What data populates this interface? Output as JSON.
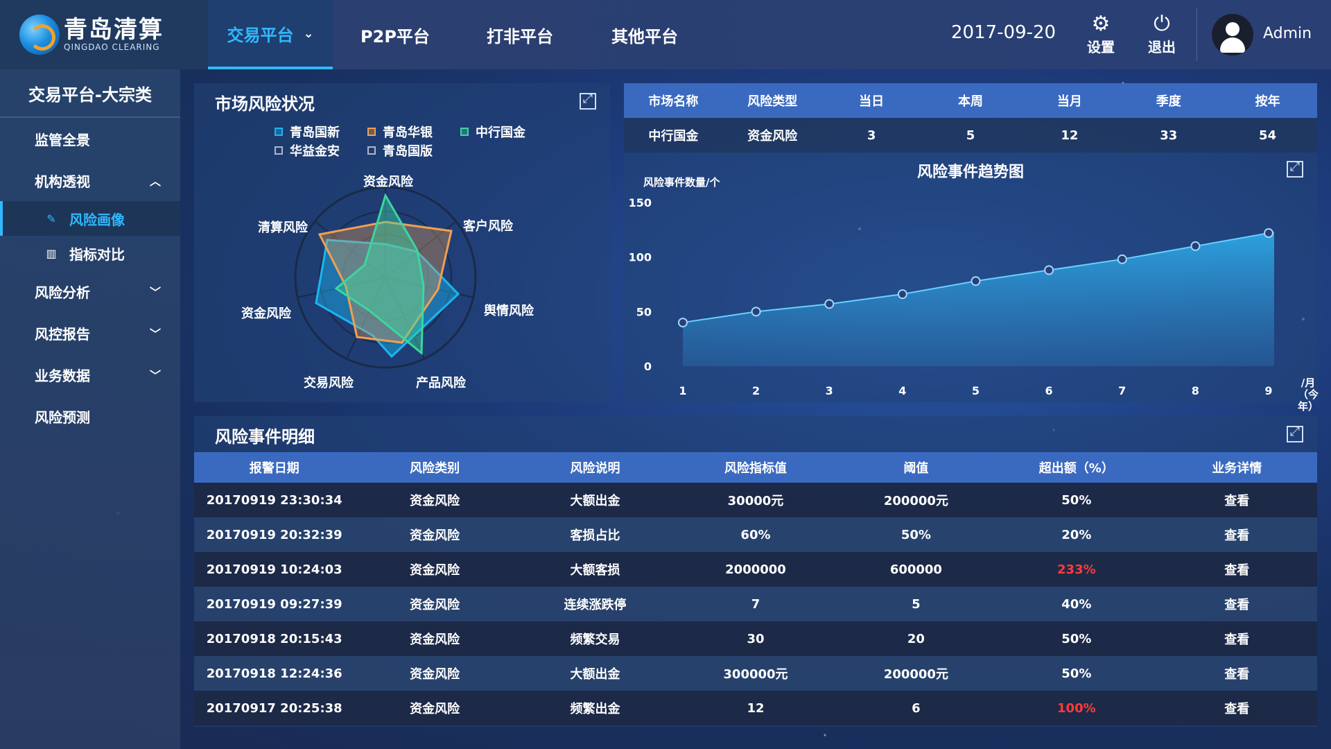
{
  "logo": {
    "cn": "青岛清算",
    "en": "QINGDAO CLEARING"
  },
  "nav": {
    "items": [
      {
        "label": "交易平台",
        "active": true
      },
      {
        "label": "P2P平台"
      },
      {
        "label": "打非平台"
      },
      {
        "label": "其他平台"
      }
    ]
  },
  "header": {
    "date": "2017-09-20",
    "settings": "设置",
    "logout": "退出",
    "user": "Admin"
  },
  "sidebar": {
    "title": "交易平台-大宗类",
    "items": [
      "监管全景",
      "机构透视",
      "风险画像",
      "指标对比",
      "风险分析",
      "风控报告",
      "业务数据",
      "风险预测"
    ]
  },
  "risk_panel": {
    "title": "市场风险状况",
    "legend": [
      {
        "name": "青岛国新",
        "color": "#1ab6f0"
      },
      {
        "name": "青岛华银",
        "color": "#f0a050"
      },
      {
        "name": "中行国金",
        "color": "#3cd6a0"
      },
      {
        "name": "华益金安",
        "color": "#b0b8c8"
      },
      {
        "name": "青岛国版",
        "color": "#b0b8c8"
      }
    ],
    "axes": [
      "资金风险",
      "客户风险",
      "舆情风险",
      "产品风险",
      "交易风险",
      "资金风险",
      "清算风险"
    ]
  },
  "market_table": {
    "headers": [
      "市场名称",
      "风险类型",
      "当日",
      "本周",
      "当月",
      "季度",
      "按年"
    ],
    "row": [
      "中行国金",
      "资金风险",
      "3",
      "5",
      "12",
      "33",
      "54"
    ]
  },
  "chart_data": {
    "type": "area",
    "title": "风险事件趋势图",
    "ylabel": "风险事件数量/个",
    "xlabel": "/月（今年）",
    "x": [
      1,
      2,
      3,
      4,
      5,
      6,
      7,
      8,
      9
    ],
    "values": [
      40,
      50,
      57,
      66,
      78,
      88,
      98,
      110,
      122
    ],
    "ylim": [
      0,
      150
    ],
    "yticks": [
      0,
      50,
      100,
      150
    ],
    "color": "#2eb3f0"
  },
  "detail": {
    "title": "风险事件明细",
    "headers": [
      "报警日期",
      "风险类别",
      "风险说明",
      "风险指标值",
      "阈值",
      "超出额（%）",
      "业务详情"
    ],
    "rows": [
      [
        "20170919  23:30:34",
        "资金风险",
        "大额出金",
        "30000元",
        "200000元",
        "50%",
        "查看"
      ],
      [
        "20170919  20:32:39",
        "资金风险",
        "客损占比",
        "60%",
        "50%",
        "20%",
        "查看"
      ],
      [
        "20170919  10:24:03",
        "资金风险",
        "大额客损",
        "2000000",
        "600000",
        "233%",
        "查看"
      ],
      [
        "20170919  09:27:39",
        "资金风险",
        "连续涨跌停",
        "7",
        "5",
        "40%",
        "查看"
      ],
      [
        "20170918  20:15:43",
        "资金风险",
        "频繁交易",
        "30",
        "20",
        "50%",
        "查看"
      ],
      [
        "20170918  12:24:36",
        "资金风险",
        "大额出金",
        "300000元",
        "200000元",
        "50%",
        "查看"
      ],
      [
        "20170917  20:25:38",
        "资金风险",
        "频繁出金",
        "12",
        "6",
        "100%",
        "查看"
      ]
    ],
    "highlight_rows": [
      2,
      6
    ],
    "highlight_color": "#ff3b3b"
  }
}
